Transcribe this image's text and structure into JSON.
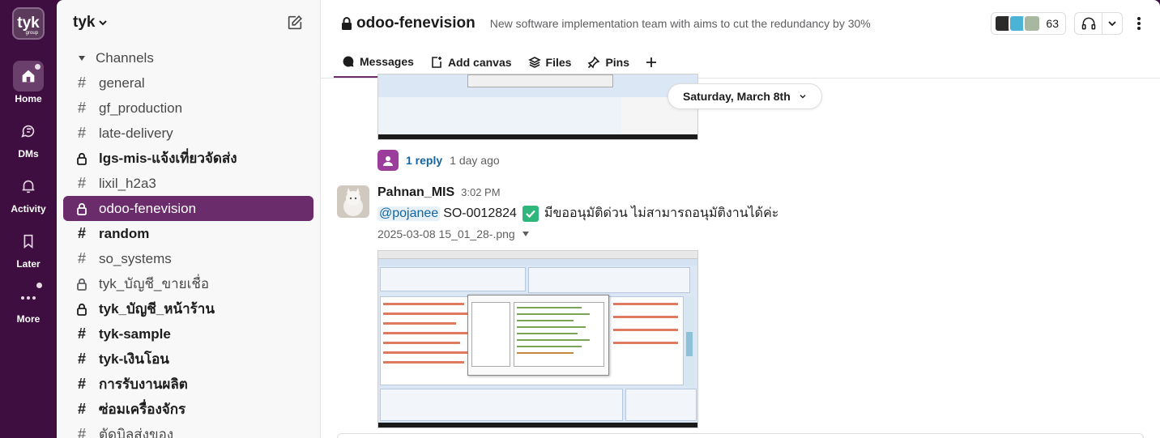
{
  "workspace": {
    "logo_text": "tyk",
    "logo_sub": "group",
    "name": "tyk"
  },
  "rail": [
    {
      "key": "home",
      "label": "Home",
      "icon": "home-icon"
    },
    {
      "key": "dms",
      "label": "DMs",
      "icon": "dm-icon"
    },
    {
      "key": "activity",
      "label": "Activity",
      "icon": "bell-icon"
    },
    {
      "key": "later",
      "label": "Later",
      "icon": "bookmark-icon"
    },
    {
      "key": "more",
      "label": "More",
      "icon": "more-icon"
    }
  ],
  "sidebar": {
    "section_label": "Channels",
    "channels": [
      {
        "name": "general",
        "type": "public",
        "bold": false
      },
      {
        "name": "gf_production",
        "type": "public",
        "bold": false
      },
      {
        "name": "late-delivery",
        "type": "public",
        "bold": false
      },
      {
        "name": "lgs-mis-แจ้งเที่ยวจัดส่ง",
        "type": "private",
        "bold": true
      },
      {
        "name": "lixil_h2a3",
        "type": "public",
        "bold": false
      },
      {
        "name": "odoo-fenevision",
        "type": "private",
        "bold": false,
        "active": true
      },
      {
        "name": "random",
        "type": "public",
        "bold": true
      },
      {
        "name": "so_systems",
        "type": "public",
        "bold": false
      },
      {
        "name": "tyk_บัญชี_ขายเชื่อ",
        "type": "private",
        "bold": false
      },
      {
        "name": "tyk_บัญชี_หน้าร้าน",
        "type": "private",
        "bold": true
      },
      {
        "name": "tyk-sample",
        "type": "public",
        "bold": true
      },
      {
        "name": "tyk-เงินโอน",
        "type": "public",
        "bold": true
      },
      {
        "name": "การรับงานผลิต",
        "type": "public",
        "bold": true
      },
      {
        "name": "ซ่อมเครื่องจักร",
        "type": "public",
        "bold": true
      },
      {
        "name": "ตัดบิลส่งของ",
        "type": "public",
        "bold": false
      }
    ]
  },
  "channel": {
    "name": "odoo-fenevision",
    "description": "New software implementation team with aims to cut the redundancy by 30%",
    "member_count": "63"
  },
  "tabs": [
    {
      "label": "Messages",
      "icon": "message-icon",
      "active": true
    },
    {
      "label": "Add canvas",
      "icon": "canvas-icon",
      "active": false
    },
    {
      "label": "Files",
      "icon": "files-icon",
      "active": false
    },
    {
      "label": "Pins",
      "icon": "pin-icon",
      "active": false
    }
  ],
  "date_divider": "Saturday, March 8th",
  "prev_thread": {
    "reply_label": "1 reply",
    "reply_time": "1 day ago"
  },
  "message": {
    "user": "Pahnan_MIS",
    "time": "3:02 PM",
    "mention": "@pojanee",
    "so_number": "SO-0012824",
    "text_thai": "มีขออนุมัติด่วน ไม่สามารถอนุมัติงานได้ค่ะ",
    "attachment_name": "2025-03-08 15_01_28-.png"
  },
  "colors": {
    "rail_bg": "#3f0e40",
    "active_channel": "#6a2c6b",
    "link": "#1264a3",
    "check": "#2eb67d"
  }
}
